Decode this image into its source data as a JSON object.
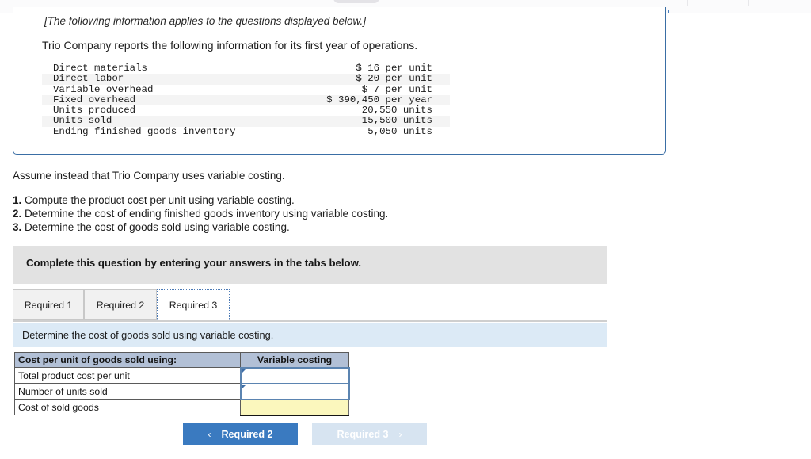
{
  "top_toolbar": {
    "pill_placeholder": "",
    "accent_color": "#4a7ebb"
  },
  "info_box": {
    "note": "[The following information applies to the questions displayed below.]",
    "lead": "Trio Company reports the following information for its first year of operations.",
    "border_color": "#3a6ea5",
    "facts": [
      {
        "label": "Direct materials",
        "value": "$ 16 per unit"
      },
      {
        "label": "Direct labor",
        "value": "$ 20 per unit"
      },
      {
        "label": "Variable overhead",
        "value": "$ 7 per unit"
      },
      {
        "label": "Fixed overhead",
        "value": "$ 390,450 per year"
      },
      {
        "label": "Units produced",
        "value": "20,550 units"
      },
      {
        "label": "Units sold",
        "value": "15,500 units"
      },
      {
        "label": "Ending finished goods inventory",
        "value": "5,050 units"
      }
    ]
  },
  "prompt": {
    "assume": "Assume instead that Trio Company uses variable costing.",
    "requirements": [
      {
        "num": "1.",
        "text": " Compute the product cost per unit using variable costing."
      },
      {
        "num": "2.",
        "text": " Determine the cost of ending finished goods inventory using variable costing."
      },
      {
        "num": "3.",
        "text": " Determine the cost of goods sold using variable costing."
      }
    ]
  },
  "complete_banner": {
    "text": "Complete this question by entering your answers in the tabs below.",
    "background": "#e2e2e2"
  },
  "tabs": {
    "items": [
      {
        "label": "Required 1",
        "active": false
      },
      {
        "label": "Required 2",
        "active": false
      },
      {
        "label": "Required 3",
        "active": true
      }
    ],
    "active_index": 2,
    "focus_outline_color": "#4a79b5"
  },
  "instruction_bar": {
    "text": "Determine the cost of goods sold using variable costing.",
    "background": "#dceaf6"
  },
  "answer_table": {
    "headers": {
      "label": "Cost per unit of goods sold using:",
      "value": "Variable costing"
    },
    "header_background": "#b2c0d6",
    "input_border_color": "#5b84b1",
    "result_background": "#fbf7bd",
    "rows": [
      {
        "label": "Total product cost per unit",
        "value": "",
        "kind": "input"
      },
      {
        "label": "Number of units sold",
        "value": "",
        "kind": "input"
      },
      {
        "label": "Cost of sold goods",
        "value": "",
        "kind": "result"
      }
    ]
  },
  "footer": {
    "prev": {
      "label": "Required 2",
      "chevron": "‹",
      "background": "#3a7ac0",
      "enabled": true
    },
    "next": {
      "label": "Required 3",
      "chevron": "›",
      "background": "#d7e4f1",
      "enabled": false
    }
  }
}
